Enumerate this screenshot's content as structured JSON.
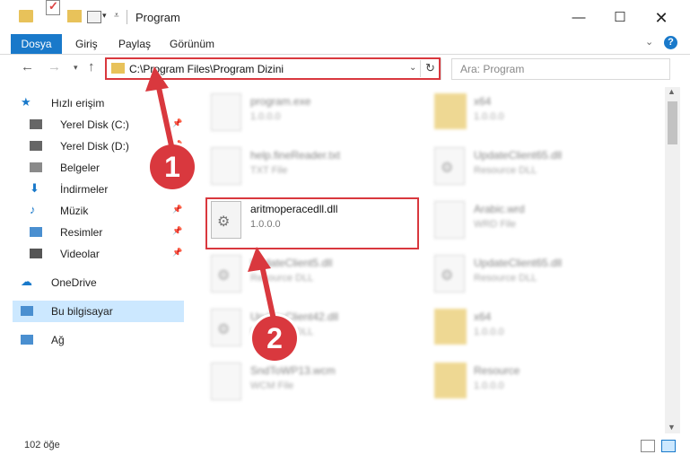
{
  "window": {
    "title": "Program",
    "min_glyph": "—",
    "max_glyph": "☐",
    "close_glyph": "✕"
  },
  "ribbon": {
    "file_tab": "Dosya",
    "tabs": [
      "Giriş",
      "Paylaş",
      "Görünüm"
    ],
    "help": "?"
  },
  "address": {
    "path": "C:\\Program Files\\Program Dizini",
    "search_placeholder": "Ara: Program"
  },
  "sidebar": {
    "items": [
      {
        "label": "Hızlı erişim",
        "icon": "star-icon",
        "pinned": false
      },
      {
        "label": "Yerel Disk (C:)",
        "icon": "drive-icon",
        "pinned": true
      },
      {
        "label": "Yerel Disk (D:)",
        "icon": "drive-icon",
        "pinned": true
      },
      {
        "label": "Belgeler",
        "icon": "documents-icon",
        "pinned": true
      },
      {
        "label": "İndirmeler",
        "icon": "download-icon",
        "pinned": true
      },
      {
        "label": "Müzik",
        "icon": "music-icon",
        "pinned": true
      },
      {
        "label": "Resimler",
        "icon": "pictures-icon",
        "pinned": true
      },
      {
        "label": "Videolar",
        "icon": "video-icon",
        "pinned": true
      },
      {
        "label": "OneDrive",
        "icon": "cloud-icon",
        "pinned": false
      },
      {
        "label": "Bu bilgisayar",
        "icon": "computer-icon",
        "pinned": false
      },
      {
        "label": "Ağ",
        "icon": "network-icon",
        "pinned": false
      }
    ]
  },
  "files": [
    {
      "name": "program.exe",
      "meta": "1.0.0.0",
      "type": "exe"
    },
    {
      "name": "x64",
      "meta": "1.0.0.0",
      "type": "folder"
    },
    {
      "name": "help.fineReader.txt",
      "meta": "TXT File",
      "type": "doc"
    },
    {
      "name": "UpdateClient65.dll",
      "meta": "Resource DLL",
      "type": "dll"
    },
    {
      "name": "aritmoperacedll.dll",
      "meta": "1.0.0.0",
      "type": "dll"
    },
    {
      "name": "Arabic.wrd",
      "meta": "WRD File",
      "type": "doc"
    },
    {
      "name": "UpdateClient5.dll",
      "meta": "Resource DLL",
      "type": "dll"
    },
    {
      "name": "UpdateClient65.dll",
      "meta": "Resource DLL",
      "type": "dll"
    },
    {
      "name": "UpdateClient42.dll",
      "meta": "Resource DLL",
      "type": "dll"
    },
    {
      "name": "x64",
      "meta": "1.0.0.0",
      "type": "folder"
    },
    {
      "name": "SndToWP13.wcm",
      "meta": "WCM File",
      "type": "doc"
    },
    {
      "name": "Resource",
      "meta": "1.0.0.0",
      "type": "folder"
    }
  ],
  "status": {
    "count": "102 öğe"
  },
  "annotations": {
    "step1": "1",
    "step2": "2"
  },
  "colors": {
    "accent": "#1979ca",
    "highlight": "#d9383e",
    "selection": "#cce8ff"
  }
}
